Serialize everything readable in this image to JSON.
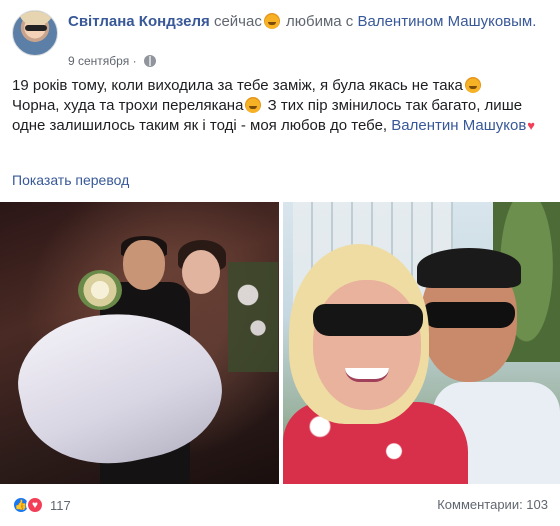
{
  "post": {
    "author": "Світлана Кондзеля",
    "time_inline": "сейчас",
    "activity": "любима с",
    "tagged_person": "Валентином Машуковым.",
    "date": "9 сентября",
    "date_separator": "·",
    "text_line1": "19 років тому, коли виходила за тебе заміж, я була якась не така",
    "text_line2": "Чорна, худа та трохи перелякана",
    "text_line3": " З тих пір змінилось так багато, лише одне залишилось таким як і тоді - моя любов до тебе, ",
    "text_link": "Валентин Машуков",
    "heart": "♥",
    "translate_label": "Показать перевод"
  },
  "footer": {
    "like_glyph": "👍",
    "love_glyph": "♥",
    "reaction_count": "117",
    "comments_label": "Комментарии: 103"
  },
  "colors": {
    "link": "#385898",
    "like": "#1877f2",
    "love": "#f33e58"
  },
  "icons": {
    "privacy": "globe-icon",
    "feeling": "smile-emoji-icon"
  }
}
